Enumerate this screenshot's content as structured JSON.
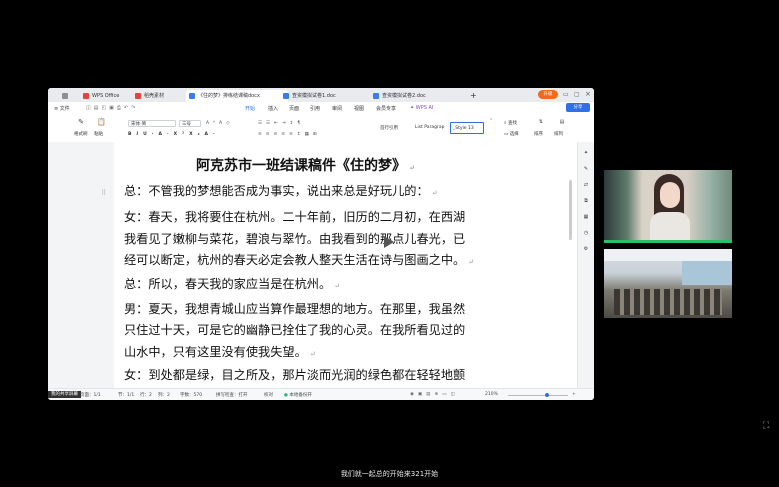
{
  "tabs": [
    {
      "label": "",
      "active": false,
      "icon": "home-icon"
    },
    {
      "label": "WPS Office",
      "active": false,
      "icon": "wps-logo-icon"
    },
    {
      "label": "稻壳素材",
      "active": false,
      "icon": "daoke-icon"
    },
    {
      "label": "《住的梦》排练结课稿docx",
      "active": true,
      "icon": "doc-icon"
    },
    {
      "label": "查资模拟试卷1.doc",
      "active": false,
      "icon": "doc-icon"
    },
    {
      "label": "查资模拟试卷2.doc",
      "active": false,
      "icon": "doc-icon"
    }
  ],
  "title_actions": {
    "upgrade": "升级",
    "share": "分享"
  },
  "menu": {
    "file": "文件",
    "items": [
      "开始",
      "插入",
      "页面",
      "引用",
      "审阅",
      "视图",
      "会员专享"
    ],
    "ai": "WPS AI"
  },
  "ribbon": {
    "format_painter": "格式刷",
    "paste": "粘贴",
    "font_name": "宋体-简",
    "font_size": "三号",
    "styles": [
      "首行引用",
      "List Paragrap",
      "_Style 13"
    ],
    "find": "查找",
    "select": "选择",
    "sort": "排序",
    "layout": "排列"
  },
  "document": {
    "title": "阿克苏市一班结课稿件《住的梦》",
    "lines": [
      "总：不管我的梦想能否成为事实，说出来总是好玩儿的：",
      "女：春天，我将要住在杭州。二十年前，旧历的二月初，在西湖",
      "我看见了嫩柳与菜花，碧浪与翠竹。由我看到的那点儿春光，已",
      "经可以断定，杭州的春天必定会教人整天生活在诗与图画之中。",
      "总：所以，春天我的家应当是在杭州。",
      "男：夏天，我想青城山应当算作最理想的地方。在那里，我虽然",
      "只住过十天，可是它的幽静已拴住了我的心灵。在我所看见过的",
      "山水中，只有这里没有使我失望。",
      "女：到处都是绿，目之所及，那片淡而光润的绿色都在轻轻地颤"
    ]
  },
  "status": {
    "share_screen": "我的共享屏幕",
    "page": "页面：1/1",
    "section": "节：1/1",
    "row": "行：2",
    "col": "列：2",
    "words": "字数：570",
    "spell": "拼写检查：打开",
    "proofread": "校对",
    "compat": "本地备份开",
    "zoom": "210%"
  },
  "caption": "我们就一起总的开始来321开始",
  "colors": {
    "accent": "#2f6fe8",
    "upgrade": "#f06a1e",
    "doc_icon": "#3b7ced",
    "pdf_icon": "#e5433a"
  }
}
